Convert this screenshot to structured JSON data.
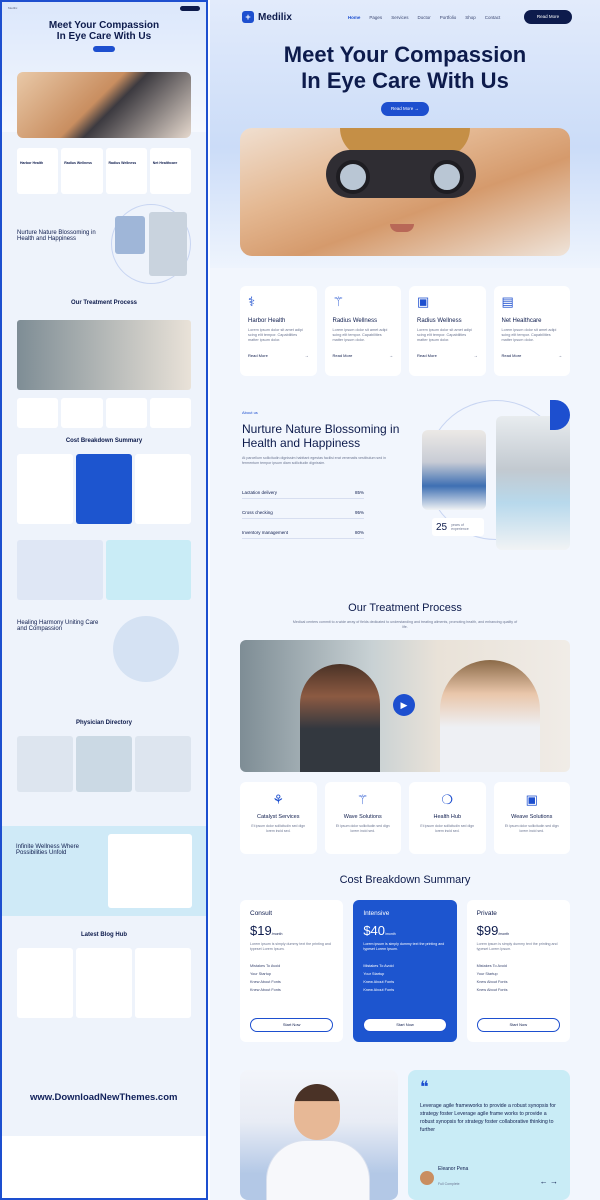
{
  "brand": {
    "name": "Medilix"
  },
  "nav": {
    "items": [
      "Home",
      "Pages",
      "Services",
      "Doctor",
      "Portfolio",
      "Shop",
      "Contact"
    ],
    "active": "Home",
    "cta": "Read More"
  },
  "hero": {
    "title_line1": "Meet Your Compassion",
    "title_line2": "In Eye Care With Us",
    "button": "Read More"
  },
  "services": [
    {
      "icon": "clipboard-icon",
      "title": "Harbor Health",
      "text": "Lorem ipsum dolor sit amet adipi scing elit tempor. Capabilities matter ipsum dolor.",
      "link": "Read More"
    },
    {
      "icon": "stethoscope-icon",
      "title": "Radius Wellness",
      "text": "Lorem ipsum dolor sit amet adipi scing elit tempor. Capabilities matter ipsum dolor.",
      "link": "Read More"
    },
    {
      "icon": "monitor-icon",
      "title": "Radius Wellness",
      "text": "Lorem ipsum dolor sit amet adipi scing elit tempor. Capabilities matter ipsum dolor.",
      "link": "Read More"
    },
    {
      "icon": "notes-icon",
      "title": "Net Healthcare",
      "text": "Lorem ipsum dolor sit amet adipi scing elit tempor. Capabilities matter ipsum dolor.",
      "link": "Read More"
    }
  ],
  "about": {
    "tag": "About us",
    "title": "Nurture Nature Blossoming in Health and Happiness",
    "text": "At parcellum sollicitudin dignissim habitant egestas facilisi erat venenatis vestibulum sed in fermentum tempor ipsum diam sollicitudin dignissim.",
    "bars": [
      {
        "label": "Lactation delivery",
        "value": "85%"
      },
      {
        "label": "Cross checking",
        "value": "95%"
      },
      {
        "label": "Inventory management",
        "value": "80%"
      }
    ],
    "years": "25",
    "years_label": "years of experience"
  },
  "process": {
    "title": "Our Treatment Process",
    "subtitle": "Medical centers commit to a wide array of fields dedicated to understanding and treating ailments, promoting health, and enhancing quality of life.",
    "features": [
      {
        "icon": "tooth-icon",
        "title": "Catalyst Services",
        "text": "Et ipsum dolor sollicitudin sed dign lorem incid sed."
      },
      {
        "icon": "stethoscope-icon",
        "title": "Wave Solutions",
        "text": "Et ipsum dolor sollicitudin sed dign lorem incid sed."
      },
      {
        "icon": "drop-icon",
        "title": "Health Hub",
        "text": "Et ipsum dolor sollicitudin sed dign lorem incid sed."
      },
      {
        "icon": "monitor-icon",
        "title": "Weave Solutions",
        "text": "Et ipsum dolor sollicitudin sed dign lorem incid sed."
      }
    ]
  },
  "cost": {
    "title": "Cost Breakdown Summary",
    "plans": [
      {
        "name": "Consult",
        "price": "$19",
        "period": "/month",
        "text": "Lorem ipsum is simply dummy text the printing and typeset Lorem Ipsum.",
        "items": [
          "Mistakes To Avoid",
          "Your Startup",
          "Knew About Fonts",
          "Knew About Fonts"
        ],
        "button": "Start Now"
      },
      {
        "name": "Intensive",
        "price": "$40",
        "period": "/month",
        "text": "Lorem ipsum is simply dummy text the printing and typeset Lorem Ipsum.",
        "items": [
          "Mistakes To Avoid",
          "Your Startup",
          "Knew About Fonts",
          "Knew About Fonts"
        ],
        "button": "Start Now"
      },
      {
        "name": "Private",
        "price": "$99",
        "period": "/month",
        "text": "Lorem ipsum is simply dummy text the printing and typeset Lorem Ipsum.",
        "items": [
          "Mistakes To Avoid",
          "Your Startup",
          "Knew About Fonts",
          "Knew About Fonts"
        ],
        "button": "Start Now"
      }
    ]
  },
  "testimonial": {
    "quote": "Leverage agile frameworks to provide a robust synopsis for strategy foster Leverage agile frame works to provide a robust synopsis for strategy foster collaborative thinking to further",
    "name": "Eleanor Pena",
    "role": "Full Complete"
  },
  "thumbnail": {
    "title_line1": "Meet Your Compassion",
    "title_line2": "In Eye Care With Us",
    "sections": [
      "Our Treatment Process",
      "Cost Breakdown Summary",
      "Healing Harmony Uniting Care and Compassion",
      "Physician Directory",
      "Infinite Wellness Where Possibilities Unfold",
      "Latest Blog Hub"
    ],
    "watermark": "www.DownloadNewThemes.com"
  }
}
